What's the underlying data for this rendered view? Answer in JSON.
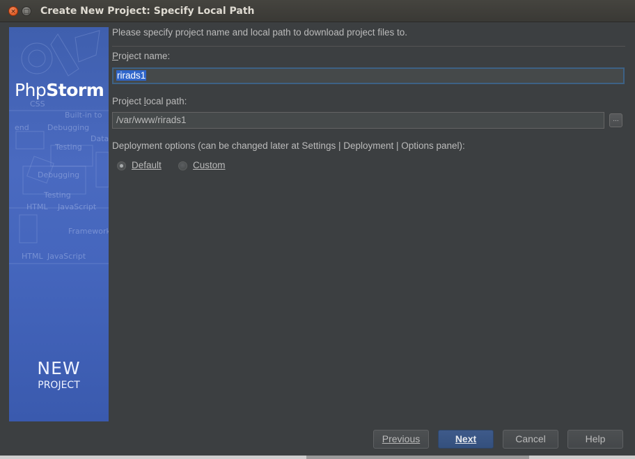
{
  "window": {
    "title": "Create New Project: Specify Local Path",
    "close_glyph": "×",
    "maximize_glyph": "□"
  },
  "banner": {
    "brand_plain": "Php",
    "brand_bold": "Storm",
    "new_label": "NEW",
    "project_label": "PROJECT",
    "background_words": [
      "Built-in to",
      "Debugging",
      "Testing",
      "Data",
      "Debugging",
      "Testing",
      "HTML",
      "JavaScript",
      "Frameworks",
      "HTML",
      "JavaScript",
      "CSS",
      "end"
    ]
  },
  "form": {
    "intro": "Please specify project name and local path to download project files to.",
    "project_name_label": "Project name:",
    "project_name_value": "rirads1",
    "local_path_label": "Project local path:",
    "local_path_value": "/var/www/rirads1",
    "browse_label": "...",
    "deployment_label": "Deployment options (can be changed later at Settings | Deployment | Options panel):",
    "deployment_options": [
      {
        "label": "Default",
        "selected": true
      },
      {
        "label": "Custom",
        "selected": false
      }
    ]
  },
  "buttons": {
    "previous": "Previous",
    "next": "Next",
    "cancel": "Cancel",
    "help": "Help"
  },
  "colors": {
    "background": "#3c3f41",
    "banner_blue": "#4566bd",
    "selection": "#2f65ca",
    "default_button": "#3e5a8a"
  }
}
